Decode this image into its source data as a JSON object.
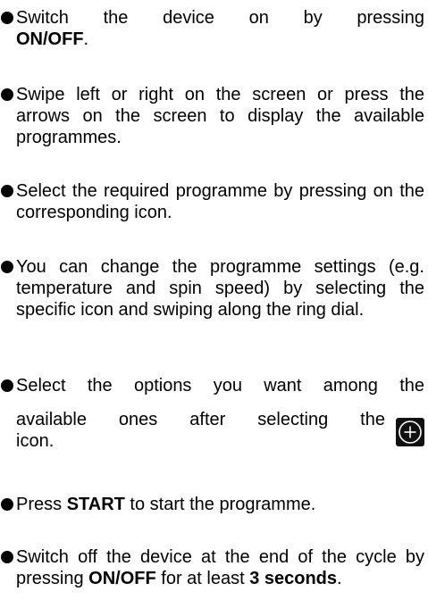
{
  "items": [
    {
      "lines": [
        {
          "pre": "Switch the device on by pressing"
        },
        {
          "bold": "ON/OFF",
          "post": "."
        }
      ]
    },
    {
      "text": "Swipe left or right on the screen or press the arrows on the screen to display the available programmes."
    },
    {
      "text": "Select the required programme by pressing on the corresponding icon."
    },
    {
      "text": "You can change the programme settings (e.g. temperature and spin speed) by selecting the specific icon and swiping along the ring dial."
    },
    {
      "line1": "Select the options you want among the",
      "line2": "available ones after selecting the",
      "line3": "icon.",
      "icon": "plus-circle-icon"
    },
    {
      "pre": "Press ",
      "bold": "START",
      "post": " to start the programme."
    },
    {
      "pre": "Switch off the device at the end of the cycle by pressing ",
      "bold1": "ON/OFF",
      "mid": " for at least ",
      "bold2": "3 seconds",
      "post": "."
    }
  ]
}
